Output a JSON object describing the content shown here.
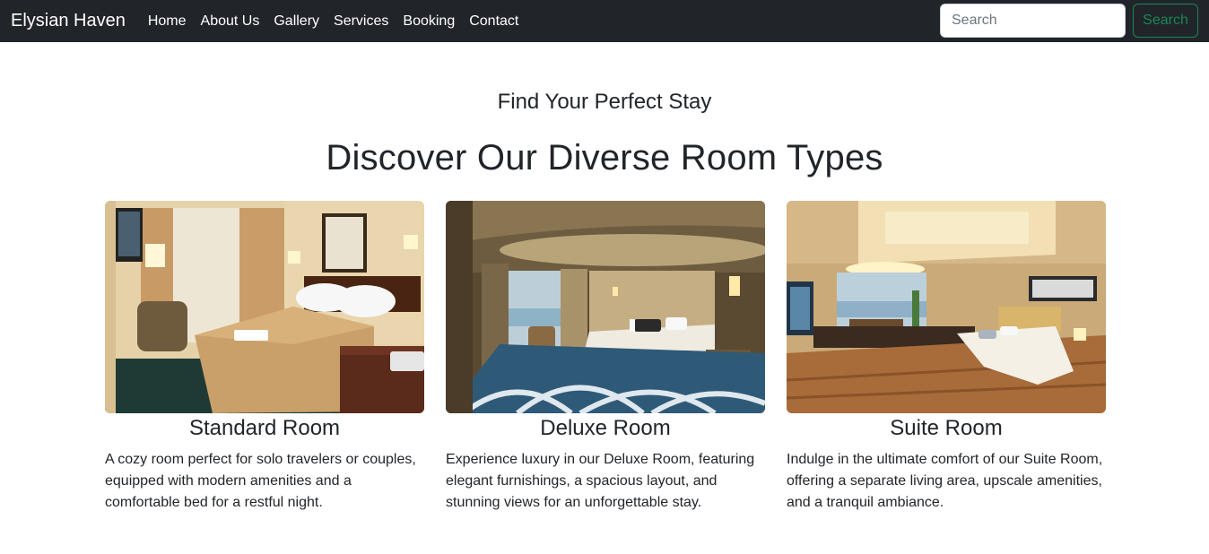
{
  "navbar": {
    "brand": "Elysian Haven",
    "links": [
      "Home",
      "About Us",
      "Gallery",
      "Services",
      "Booking",
      "Contact"
    ],
    "search": {
      "placeholder": "Search",
      "value": "",
      "button_label": "Search"
    }
  },
  "hero": {
    "kicker": "Find Your Perfect Stay",
    "headline": "Discover Our Diverse Room Types"
  },
  "rooms": [
    {
      "title": "Standard Room",
      "description": "A cozy room perfect for solo travelers or couples, equipped with modern amenities and a comfortable bed for a restful night."
    },
    {
      "title": "Deluxe Room",
      "description": "Experience luxury in our Deluxe Room, featuring elegant furnishings, a spacious layout, and stunning views for an unforgettable stay."
    },
    {
      "title": "Suite Room",
      "description": "Indulge in the ultimate comfort of our Suite Room, offering a separate living area, upscale amenities, and a tranquil ambiance."
    }
  ],
  "colors": {
    "navbar_bg": "#212529",
    "accent_green": "#198754",
    "text": "#212529"
  }
}
